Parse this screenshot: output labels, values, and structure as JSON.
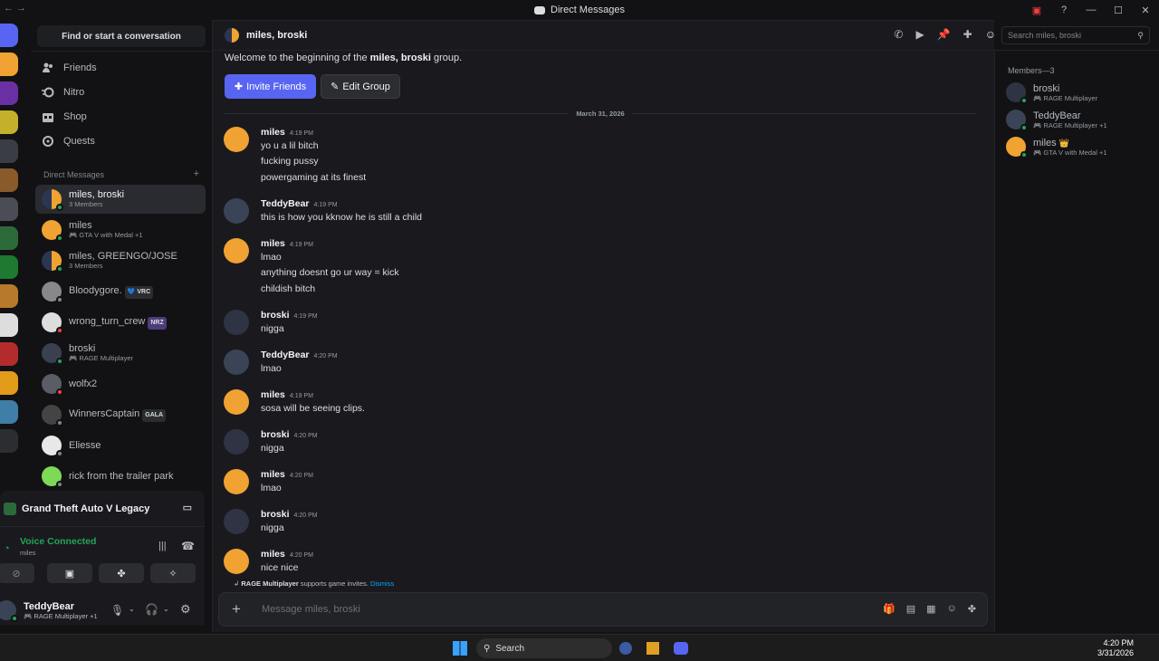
{
  "window": {
    "title": "Direct Messages"
  },
  "sidebar": {
    "find_placeholder": "Find or start a conversation",
    "nav": [
      {
        "label": "Friends"
      },
      {
        "label": "Nitro"
      },
      {
        "label": "Shop"
      },
      {
        "label": "Quests"
      }
    ],
    "dm_header": "Direct Messages",
    "dm_add": "+",
    "dms": [
      {
        "name": "miles, broski",
        "sub": "3 Members",
        "selected": true
      },
      {
        "name": "miles",
        "sub": "🎮 GTA V with Medal +1"
      },
      {
        "name": "miles, GREENGO/JOSE",
        "sub": "3 Members"
      },
      {
        "name": "Bloodygore.",
        "tag": "💙 VRC"
      },
      {
        "name": "wrong_turn_crew",
        "tag": "NRZ"
      },
      {
        "name": "broski",
        "sub": "🎮 RAGE Multiplayer"
      },
      {
        "name": "wolfx2"
      },
      {
        "name": "WinnersCaptain",
        "tag": "GALA"
      },
      {
        "name": "Eliesse"
      },
      {
        "name": "rick from the trailer park"
      }
    ]
  },
  "panel": {
    "game": "Grand Theft Auto V Legacy",
    "voice_status": "Voice Connected",
    "voice_channel": "miles"
  },
  "user": {
    "name": "TeddyBear",
    "status": "🎮 RAGE Multiplayer +1"
  },
  "header": {
    "name": "miles, broski",
    "search_placeholder": "Search miles, broski"
  },
  "welcome": {
    "prefix": "Welcome to the beginning of the ",
    "group": "miles, broski",
    "suffix": " group."
  },
  "buttons": {
    "invite": "Invite Friends",
    "edit": "Edit Group"
  },
  "date_divider": "March 31, 2026",
  "messages": [
    {
      "author": "miles",
      "time": "4:19 PM",
      "lines": [
        "yo u a lil bitch",
        "fucking pussy",
        "powergaming at its finest"
      ]
    },
    {
      "author": "TeddyBear",
      "time": "4:19 PM",
      "lines": [
        "this is how you kknow he is still a child"
      ]
    },
    {
      "author": "miles",
      "time": "4:19 PM",
      "lines": [
        "lmao",
        "anything doesnt go ur way = kick",
        "childish bitch"
      ]
    },
    {
      "author": "broski",
      "time": "4:19 PM",
      "lines": [
        "nigga"
      ]
    },
    {
      "author": "TeddyBear",
      "time": "4:20 PM",
      "lines": [
        "lmao"
      ]
    },
    {
      "author": "miles",
      "time": "4:19 PM",
      "lines": [
        "sosa will be seeing clips."
      ]
    },
    {
      "author": "broski",
      "time": "4:20 PM",
      "lines": [
        "nigga"
      ]
    },
    {
      "author": "miles",
      "time": "4:20 PM",
      "lines": [
        "lmao"
      ]
    },
    {
      "author": "broski",
      "time": "4:20 PM",
      "lines": [
        "nigga"
      ]
    },
    {
      "author": "miles",
      "time": "4:20 PM",
      "lines": [
        "nice nice"
      ]
    }
  ],
  "hint": {
    "app": "RAGE Multiplayer",
    "text": " supports game invites. ",
    "dismiss": "Dismiss"
  },
  "composer": {
    "placeholder": "Message miles, broski"
  },
  "members": {
    "header": "Members—3",
    "list": [
      {
        "name": "broski",
        "sub": "🎮 RAGE Multiplayer"
      },
      {
        "name": "TeddyBear",
        "sub": "🎮 RAGE Multiplayer +1"
      },
      {
        "name": "miles",
        "sub": "🎮 GTA V with Medal +1",
        "owner": "👑"
      }
    ]
  },
  "taskbar": {
    "search": "Search",
    "time": "4:20 PM",
    "date": "3/31/2026"
  },
  "colors": {
    "accent": "#5865f2",
    "online": "#23a55a",
    "dnd": "#f23f43",
    "discord_orange": "#f0a232"
  }
}
